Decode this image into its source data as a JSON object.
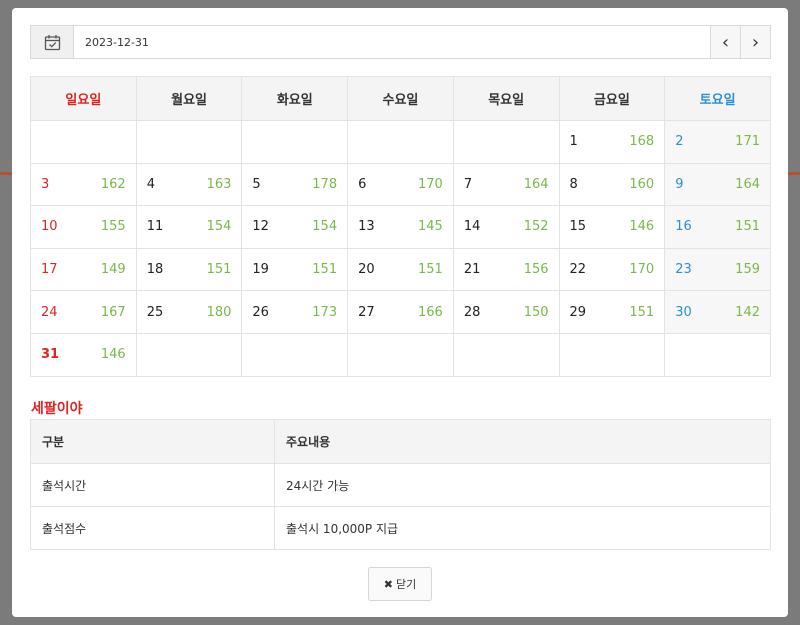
{
  "date_input": {
    "value": "2023-12-31"
  },
  "nav": {
    "prev": "‹",
    "next": "›"
  },
  "calendar": {
    "weekdays": [
      "일요일",
      "월요일",
      "화요일",
      "수요일",
      "목요일",
      "금요일",
      "토요일"
    ],
    "weeks": [
      [
        null,
        null,
        null,
        null,
        null,
        {
          "day": "1",
          "count": "168"
        },
        {
          "day": "2",
          "count": "171"
        }
      ],
      [
        {
          "day": "3",
          "count": "162"
        },
        {
          "day": "4",
          "count": "163"
        },
        {
          "day": "5",
          "count": "178"
        },
        {
          "day": "6",
          "count": "170"
        },
        {
          "day": "7",
          "count": "164"
        },
        {
          "day": "8",
          "count": "160"
        },
        {
          "day": "9",
          "count": "164"
        }
      ],
      [
        {
          "day": "10",
          "count": "155"
        },
        {
          "day": "11",
          "count": "154"
        },
        {
          "day": "12",
          "count": "154"
        },
        {
          "day": "13",
          "count": "145"
        },
        {
          "day": "14",
          "count": "152"
        },
        {
          "day": "15",
          "count": "146"
        },
        {
          "day": "16",
          "count": "151"
        }
      ],
      [
        {
          "day": "17",
          "count": "149"
        },
        {
          "day": "18",
          "count": "151"
        },
        {
          "day": "19",
          "count": "151"
        },
        {
          "day": "20",
          "count": "151"
        },
        {
          "day": "21",
          "count": "156"
        },
        {
          "day": "22",
          "count": "170"
        },
        {
          "day": "23",
          "count": "159"
        }
      ],
      [
        {
          "day": "24",
          "count": "167"
        },
        {
          "day": "25",
          "count": "180"
        },
        {
          "day": "26",
          "count": "173"
        },
        {
          "day": "27",
          "count": "166"
        },
        {
          "day": "28",
          "count": "150"
        },
        {
          "day": "29",
          "count": "151"
        },
        {
          "day": "30",
          "count": "142"
        }
      ],
      [
        {
          "day": "31",
          "count": "146",
          "today": true
        },
        null,
        null,
        null,
        null,
        null,
        null
      ]
    ]
  },
  "info": {
    "title": "세팔이야",
    "headers": [
      "구분",
      "주요내용"
    ],
    "rows": [
      [
        "출석시간",
        "24시간 가능"
      ],
      [
        "출석점수",
        "출석시 10,000P 지급"
      ]
    ]
  },
  "close_button": {
    "label": "닫기"
  },
  "colors": {
    "sunday": "#e02424",
    "saturday": "#2b8fd6",
    "count": "#7ab94a"
  }
}
